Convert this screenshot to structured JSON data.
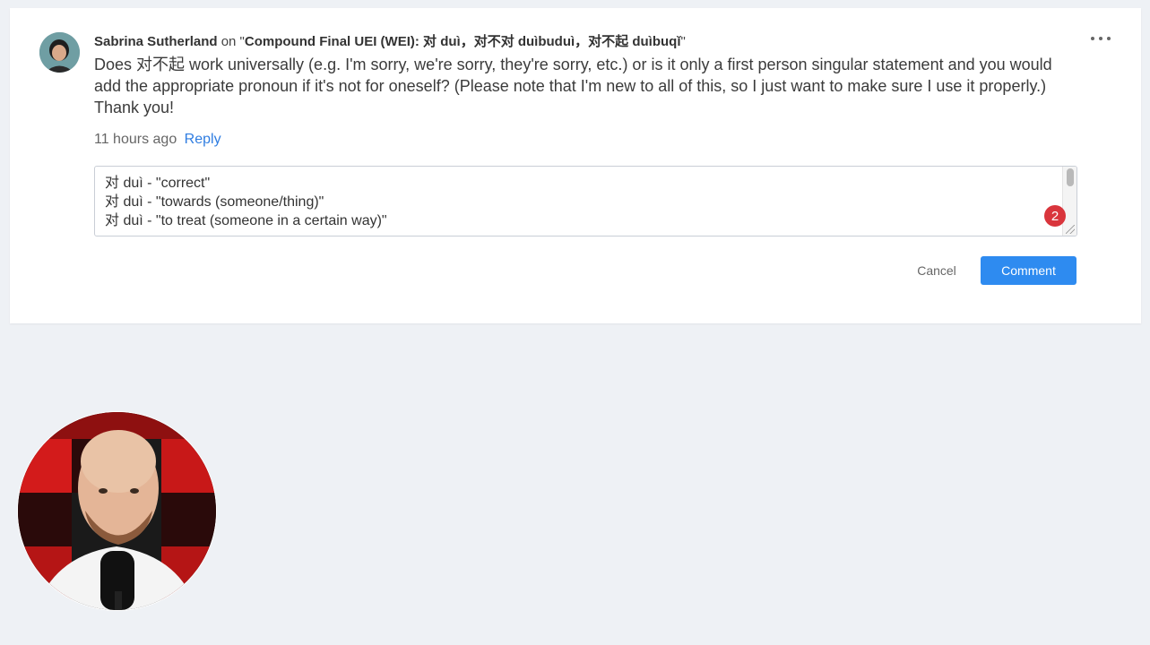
{
  "comment": {
    "author": "Sabrina Sutherland",
    "on_text": "on \"",
    "lesson_title": "Compound Final UEI (WEI): 对 duì，对不对 duìbuduì，对不起 duìbuqǐ",
    "close_quote": "\"",
    "body": "Does 对不起 work universally (e.g. I'm sorry, we're sorry, they're sorry, etc.) or is it only a first person singular statement and you would add the appropriate pronoun if it's not for oneself? (Please note that I'm new to all of this, so I just want to make sure I use it properly.) Thank you!",
    "time_ago": "11 hours ago",
    "reply_label": "Reply",
    "more_icon": "ellipsis-icon"
  },
  "reply_box": {
    "lines": [
      "对 duì - \"correct\"",
      "对 duì - \"towards (someone/thing)\"",
      "对 duì - \"to treat (someone in a certain way)\""
    ],
    "badge_count": "2",
    "cancel_label": "Cancel",
    "comment_label": "Comment"
  },
  "colors": {
    "accent": "#2e8bf0",
    "link": "#2f7de1",
    "badge": "#d9353c",
    "background": "#eef1f5"
  }
}
